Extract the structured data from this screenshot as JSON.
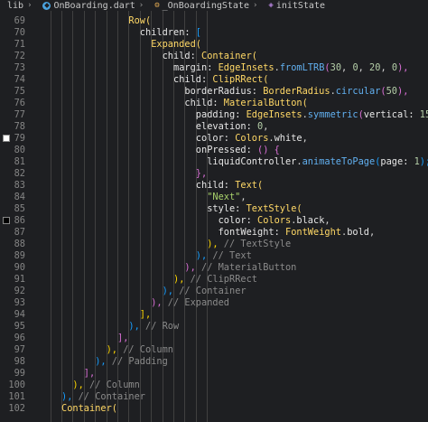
{
  "breadcrumb": {
    "folder": "lib",
    "file": "OnBoarding.dart",
    "class": "_OnBoardingState",
    "method": "initState",
    "top_partial": "_OnBoardingState"
  },
  "swatches": [
    {
      "line": "79",
      "color": "#ffffff"
    },
    {
      "line": "86",
      "color": "#000000"
    }
  ],
  "lines": [
    {
      "n": "69",
      "tokens": [
        [
          "Row(",
          "cls"
        ]
      ]
    },
    {
      "n": "70",
      "tokens": [
        [
          "children: ",
          "prop"
        ],
        [
          "[",
          "br3"
        ]
      ]
    },
    {
      "n": "71",
      "tokens": [
        [
          "Expanded(",
          "cls"
        ]
      ]
    },
    {
      "n": "72",
      "tokens": [
        [
          "child: ",
          "prop"
        ],
        [
          "Container(",
          "cls"
        ]
      ]
    },
    {
      "n": "73",
      "tokens": [
        [
          "margin: ",
          "prop"
        ],
        [
          "EdgeInsets",
          "cls"
        ],
        [
          ".",
          "pl"
        ],
        [
          "fromLTRB",
          "fn"
        ],
        [
          "(",
          "br2"
        ],
        [
          "30",
          "num"
        ],
        [
          ", ",
          "pl"
        ],
        [
          "0",
          "num"
        ],
        [
          ", ",
          "pl"
        ],
        [
          "20",
          "num"
        ],
        [
          ", ",
          "pl"
        ],
        [
          "0",
          "num"
        ],
        [
          "),",
          "br2"
        ]
      ]
    },
    {
      "n": "74",
      "tokens": [
        [
          "child: ",
          "prop"
        ],
        [
          "ClipRRect(",
          "cls"
        ]
      ]
    },
    {
      "n": "75",
      "tokens": [
        [
          "borderRadius: ",
          "prop"
        ],
        [
          "BorderRadius",
          "cls"
        ],
        [
          ".",
          "pl"
        ],
        [
          "circular",
          "fn"
        ],
        [
          "(",
          "br2"
        ],
        [
          "50",
          "num"
        ],
        [
          "),",
          "br2"
        ]
      ]
    },
    {
      "n": "76",
      "tokens": [
        [
          "child: ",
          "prop"
        ],
        [
          "MaterialButton(",
          "cls"
        ]
      ]
    },
    {
      "n": "77",
      "tokens": [
        [
          "padding: ",
          "prop"
        ],
        [
          "EdgeInsets",
          "cls"
        ],
        [
          ".",
          "pl"
        ],
        [
          "symmetric",
          "fn"
        ],
        [
          "(",
          "br2"
        ],
        [
          "vertical: ",
          "prop"
        ],
        [
          "15",
          "num"
        ],
        [
          "),",
          "br2"
        ]
      ]
    },
    {
      "n": "78",
      "tokens": [
        [
          "elevation: ",
          "prop"
        ],
        [
          "0",
          "num"
        ],
        [
          ",",
          "pl"
        ]
      ]
    },
    {
      "n": "79",
      "tokens": [
        [
          "color: ",
          "prop"
        ],
        [
          "Colors",
          "cls"
        ],
        [
          ".",
          "pl"
        ],
        [
          "white",
          "prop"
        ],
        [
          ",",
          "pl"
        ]
      ]
    },
    {
      "n": "80",
      "tokens": [
        [
          "onPressed: ",
          "prop"
        ],
        [
          "()",
          "br2"
        ],
        [
          " ",
          "pl"
        ],
        [
          "{",
          "br2"
        ]
      ]
    },
    {
      "n": "81",
      "tokens": [
        [
          "liquidController",
          "prop"
        ],
        [
          ".",
          "pl"
        ],
        [
          "animateToPage",
          "fn"
        ],
        [
          "(",
          "br3"
        ],
        [
          "page: ",
          "prop"
        ],
        [
          "1",
          "num"
        ],
        [
          ");",
          "br3"
        ]
      ]
    },
    {
      "n": "82",
      "tokens": [
        [
          "},",
          "br2"
        ]
      ]
    },
    {
      "n": "83",
      "tokens": [
        [
          "child: ",
          "prop"
        ],
        [
          "Text(",
          "cls"
        ]
      ]
    },
    {
      "n": "84",
      "tokens": [
        [
          "\"Next\"",
          "str"
        ],
        [
          ",",
          "pl"
        ]
      ]
    },
    {
      "n": "85",
      "tokens": [
        [
          "style: ",
          "prop"
        ],
        [
          "TextStyle(",
          "cls"
        ]
      ]
    },
    {
      "n": "86",
      "tokens": [
        [
          "color: ",
          "prop"
        ],
        [
          "Colors",
          "cls"
        ],
        [
          ".",
          "pl"
        ],
        [
          "black",
          "prop"
        ],
        [
          ",",
          "pl"
        ]
      ]
    },
    {
      "n": "87",
      "tokens": [
        [
          "fontWeight: ",
          "prop"
        ],
        [
          "FontWeight",
          "cls"
        ],
        [
          ".",
          "pl"
        ],
        [
          "bold",
          "prop"
        ],
        [
          ",",
          "pl"
        ]
      ]
    },
    {
      "n": "88",
      "tokens": [
        [
          "),",
          "br1"
        ],
        [
          " // TextStyle",
          "cm"
        ]
      ]
    },
    {
      "n": "89",
      "tokens": [
        [
          "),",
          "br3"
        ],
        [
          " // Text",
          "cm"
        ]
      ]
    },
    {
      "n": "90",
      "tokens": [
        [
          "),",
          "br2"
        ],
        [
          " // MaterialButton",
          "cm"
        ]
      ]
    },
    {
      "n": "91",
      "tokens": [
        [
          "),",
          "br1"
        ],
        [
          " // ClipRRect",
          "cm"
        ]
      ]
    },
    {
      "n": "92",
      "tokens": [
        [
          "),",
          "br3"
        ],
        [
          " // Container",
          "cm"
        ]
      ]
    },
    {
      "n": "93",
      "tokens": [
        [
          "),",
          "br2"
        ],
        [
          " // Expanded",
          "cm"
        ]
      ]
    },
    {
      "n": "94",
      "tokens": [
        [
          "],",
          "br1"
        ]
      ]
    },
    {
      "n": "95",
      "tokens": [
        [
          "),",
          "br3"
        ],
        [
          " // Row",
          "cm"
        ]
      ]
    },
    {
      "n": "96",
      "tokens": [
        [
          "],",
          "br2"
        ]
      ]
    },
    {
      "n": "97",
      "tokens": [
        [
          "),",
          "br1"
        ],
        [
          " // Column",
          "cm"
        ]
      ]
    },
    {
      "n": "98",
      "tokens": [
        [
          "),",
          "br3"
        ],
        [
          " // Padding",
          "cm"
        ]
      ]
    },
    {
      "n": "99",
      "tokens": [
        [
          "],",
          "br2"
        ]
      ]
    },
    {
      "n": "100",
      "tokens": [
        [
          "),",
          "br1"
        ],
        [
          " // Column",
          "cm"
        ]
      ]
    },
    {
      "n": "101",
      "tokens": [
        [
          "),",
          "br3"
        ],
        [
          " // Container",
          "cm"
        ]
      ]
    },
    {
      "n": "102",
      "tokens": [
        [
          "Container(",
          "cls"
        ]
      ]
    }
  ]
}
